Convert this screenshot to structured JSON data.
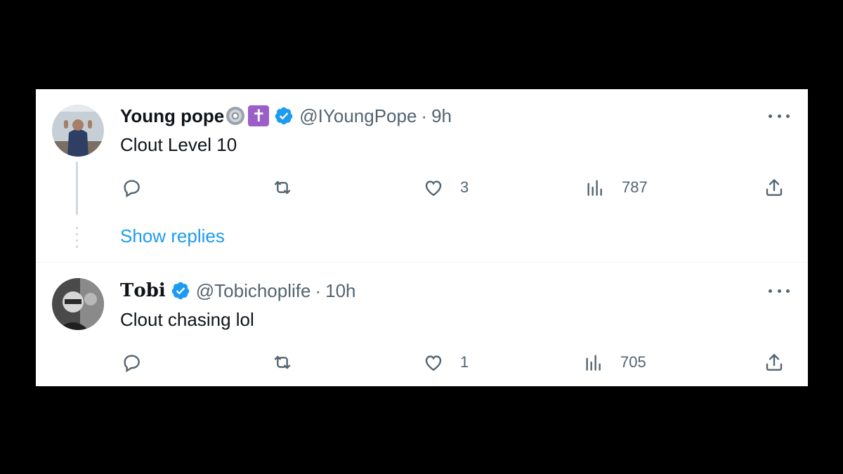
{
  "tweets": [
    {
      "display_name": "Young pope",
      "name_emojis": [
        "optical-disc-emoji",
        "latin-cross-emoji"
      ],
      "verified": true,
      "handle": "@IYoungPope",
      "separator": "·",
      "time": "9h",
      "text": "Clout Level 10",
      "stats": {
        "replies": "",
        "retweets": "",
        "likes": "3",
        "views": "787"
      }
    },
    {
      "display_name": "𝐓𝐨𝐛𝐢",
      "verified": true,
      "handle": "@Tobichoplife",
      "separator": "·",
      "time": "10h",
      "text": "Clout chasing lol",
      "stats": {
        "replies": "",
        "retweets": "",
        "likes": "1",
        "views": "705"
      }
    }
  ],
  "thread": {
    "show_replies_label": "Show replies"
  },
  "icons": [
    "reply-icon",
    "retweet-icon",
    "like-icon",
    "views-icon",
    "share-icon",
    "more-icon",
    "verified-badge-icon"
  ],
  "colors": {
    "accent": "#1d9bf0",
    "text": "#0f1419",
    "secondary": "#536471",
    "background": "#ffffff",
    "frame": "#000000",
    "emoji_cross": "#9b5fc7"
  }
}
